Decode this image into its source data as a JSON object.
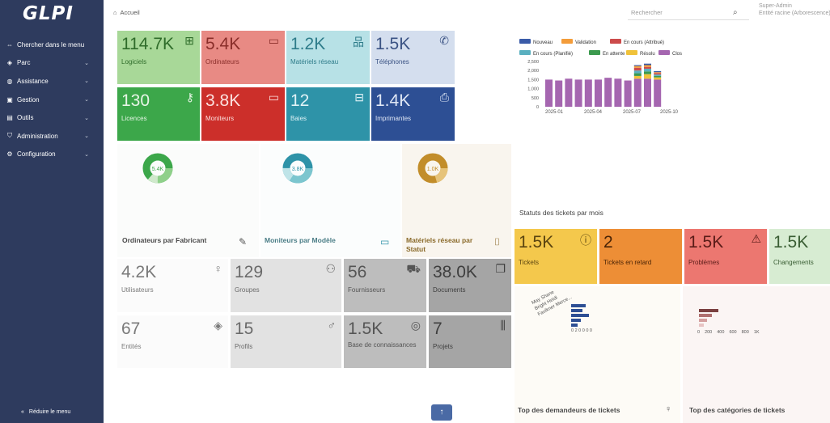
{
  "app": {
    "logo": "GLPI"
  },
  "sidebar": {
    "items": [
      {
        "label": "Chercher dans le menu",
        "icon": "arrows-icon",
        "glyph": "⇔",
        "chev": ""
      },
      {
        "label": "Parc",
        "icon": "box-icon",
        "glyph": "◈",
        "chev": "⌄"
      },
      {
        "label": "Assistance",
        "icon": "headset-icon",
        "glyph": "◍",
        "chev": "⌄"
      },
      {
        "label": "Gestion",
        "icon": "wallet-icon",
        "glyph": "▣",
        "chev": "⌄"
      },
      {
        "label": "Outils",
        "icon": "briefcase-icon",
        "glyph": "▤",
        "chev": "⌄"
      },
      {
        "label": "Administration",
        "icon": "shield-icon",
        "glyph": "⛉",
        "chev": "⌄"
      },
      {
        "label": "Configuration",
        "icon": "gear-icon",
        "glyph": "⚙",
        "chev": "⌄"
      }
    ],
    "reduce_label": "Réduire le menu",
    "reduce_glyph": "«"
  },
  "header": {
    "breadcrumb": "Accueil",
    "home_glyph": "⌂",
    "search_placeholder": "Rechercher",
    "search_glyph": "⌕",
    "user_name": "Super-Admin",
    "user_entity": "Entité racine (Arborescence)"
  },
  "tiles_top": [
    {
      "value": "114.7K",
      "label": "Logiciels",
      "icon": "apps-icon",
      "glyph": "⊞"
    },
    {
      "value": "5.4K",
      "label": "Ordinateurs",
      "icon": "laptop-icon",
      "glyph": "▭"
    },
    {
      "value": "1.2K",
      "label": "Matériels réseau",
      "icon": "network-icon",
      "glyph": "品"
    },
    {
      "value": "1.5K",
      "label": "Téléphones",
      "icon": "phone-icon",
      "glyph": "✆"
    },
    {
      "value": "130",
      "label": "Licences",
      "icon": "key-icon",
      "glyph": "⚷"
    },
    {
      "value": "3.8K",
      "label": "Moniteurs",
      "icon": "monitor-icon",
      "glyph": "▭"
    },
    {
      "value": "12",
      "label": "Baies",
      "icon": "server-icon",
      "glyph": "⊟"
    },
    {
      "value": "1.4K",
      "label": "Imprimantes",
      "icon": "printer-icon",
      "glyph": "⎙"
    }
  ],
  "donuts": [
    {
      "title": "Ordinateurs par Fabricant",
      "center": "5.4K",
      "icon": "edit-icon",
      "glyph": "✎"
    },
    {
      "title": "Moniteurs par Modèle",
      "center": "3.8K",
      "icon": "monitor-icon",
      "glyph": "▭"
    },
    {
      "title": "Matériels réseau par Statut",
      "center": "1.0K",
      "icon": "tag-icon",
      "glyph": "⌷"
    }
  ],
  "tiles_bottom": [
    {
      "value": "4.2K",
      "label": "Utilisateurs",
      "icon": "user-icon",
      "glyph": "♀"
    },
    {
      "value": "129",
      "label": "Groupes",
      "icon": "users-icon",
      "glyph": "⚇"
    },
    {
      "value": "56",
      "label": "Fournisseurs",
      "icon": "cart-icon",
      "glyph": "⛟"
    },
    {
      "value": "38.0K",
      "label": "Documents",
      "icon": "files-icon",
      "glyph": "❐"
    },
    {
      "value": "67",
      "label": "Entités",
      "icon": "layers-icon",
      "glyph": "◈"
    },
    {
      "value": "15",
      "label": "Profils",
      "icon": "user-check-icon",
      "glyph": "♂"
    },
    {
      "value": "1.5K",
      "label": "Base de connaissances",
      "icon": "lifebuoy-icon",
      "glyph": "◎"
    },
    {
      "value": "7",
      "label": "Projets",
      "icon": "columns-icon",
      "glyph": "⫼"
    }
  ],
  "status_title": "Statuts des tickets par mois",
  "tickets_tiles": [
    {
      "value": "1.5K",
      "label": "Tickets",
      "icon": "alert-circle-icon",
      "glyph": "ⓘ"
    },
    {
      "value": "2",
      "label": "Tickets en retard",
      "icon": "",
      "glyph": ""
    },
    {
      "value": "1.5K",
      "label": "Problèmes",
      "icon": "alert-triangle-icon",
      "glyph": "⚠"
    },
    {
      "value": "1.5K",
      "label": "Changements",
      "icon": "",
      "glyph": ""
    }
  ],
  "bottom_titles": {
    "requesters": "Top des demandeurs de tickets",
    "requesters_glyph": "♀",
    "categories": "Top des catégories de tickets"
  },
  "requester_names": [
    "May Shane",
    "Bright Heidi",
    "Faulkner Merce..."
  ],
  "requester_axis": "0 2 0 0 0 0",
  "category_axis": [
    "0",
    "200",
    "400",
    "600",
    "800",
    "1K"
  ],
  "scroll_top_glyph": "↑",
  "colors": {
    "sidebar": "#2e3b5e",
    "nouveau": "#3a5ba8",
    "validation": "#f39c3a",
    "attribue": "#cc4b4b",
    "planifie": "#5ab0c0",
    "attente": "#3c9a4e",
    "resolu": "#f0c23a",
    "clos": "#a566b0"
  },
  "chart_data": {
    "type": "bar",
    "stacked": true,
    "title": "",
    "categories": [
      "2025-01",
      "2025-04",
      "2025-07",
      "2025-10"
    ],
    "legend": [
      "Nouveau",
      "Validation",
      "En cours (Attribué)",
      "En cours (Planifié)",
      "En attente",
      "Résolu",
      "Clos"
    ],
    "ylim": [
      0,
      2500
    ],
    "yticks": [
      "2,500",
      "2,000",
      "1,500",
      "1,000",
      "500",
      "0"
    ],
    "series": [
      {
        "name": "Clos",
        "values": [
          1500,
          1450,
          1550,
          1500,
          1500,
          1500,
          1600,
          1550,
          1450,
          1550,
          1550,
          1500
        ]
      },
      {
        "name": "Résolu",
        "values": [
          0,
          0,
          0,
          0,
          0,
          0,
          0,
          0,
          0,
          150,
          250,
          120
        ]
      },
      {
        "name": "En attente",
        "values": [
          0,
          0,
          0,
          0,
          0,
          0,
          0,
          0,
          0,
          150,
          150,
          80
        ]
      },
      {
        "name": "En cours (Planifié)",
        "values": [
          0,
          0,
          0,
          0,
          0,
          0,
          0,
          0,
          0,
          150,
          150,
          80
        ]
      },
      {
        "name": "En cours (Attribué)",
        "values": [
          0,
          0,
          0,
          0,
          0,
          0,
          0,
          0,
          0,
          150,
          100,
          80
        ]
      },
      {
        "name": "Validation",
        "values": [
          0,
          0,
          0,
          0,
          0,
          0,
          0,
          0,
          0,
          100,
          100,
          50
        ]
      },
      {
        "name": "Nouveau",
        "values": [
          0,
          0,
          0,
          0,
          0,
          0,
          0,
          0,
          0,
          50,
          80,
          60
        ]
      }
    ]
  }
}
